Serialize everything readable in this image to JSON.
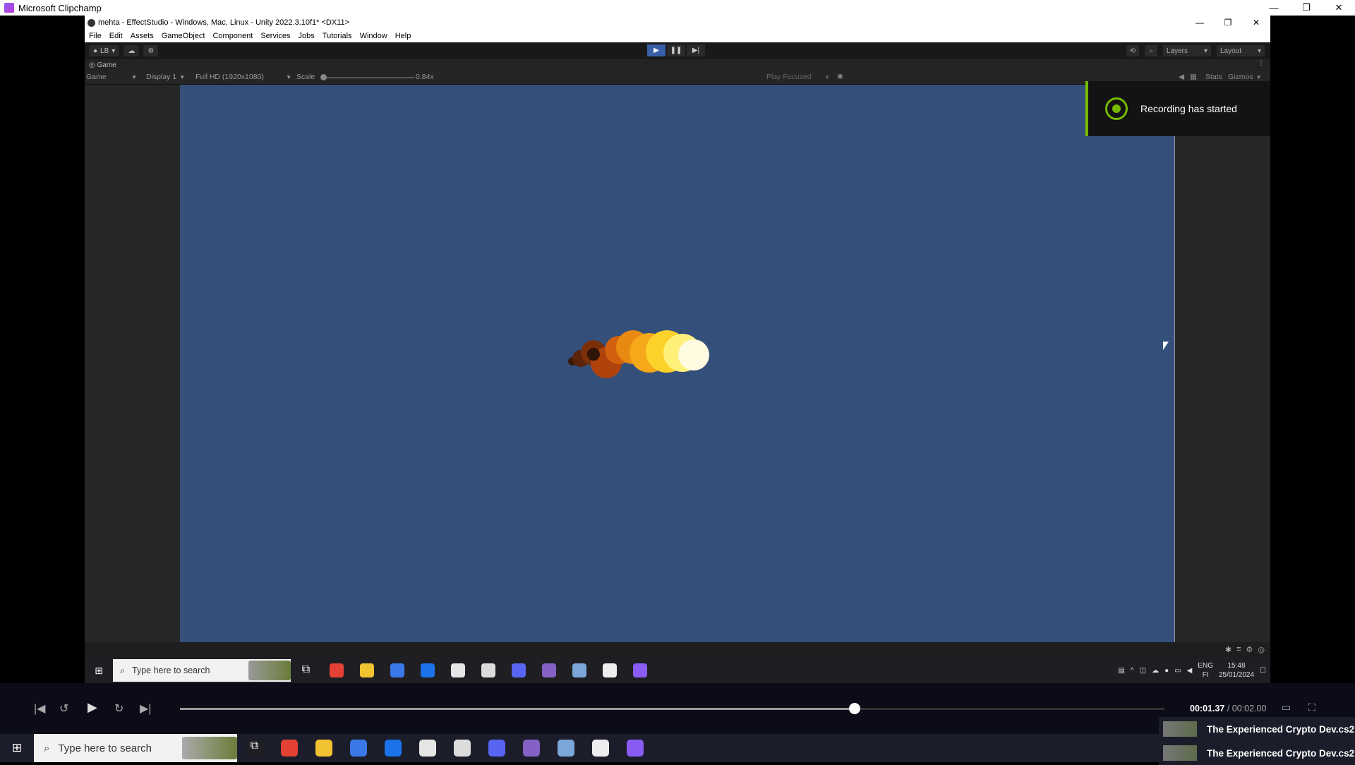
{
  "outer_window": {
    "title": "Microsoft Clipchamp",
    "minimize": "—",
    "maximize": "❐",
    "close": "✕"
  },
  "unity": {
    "title": "mehta - EffectStudio - Windows, Mac, Linux - Unity 2022.3.10f1* <DX11>",
    "menu": [
      "File",
      "Edit",
      "Assets",
      "GameObject",
      "Component",
      "Services",
      "Jobs",
      "Tutorials",
      "Window",
      "Help"
    ],
    "toolbar": {
      "account_label": "LB",
      "play_icon": "▶",
      "pause_icon": "❚❚",
      "step_icon": "▶|",
      "layers_label": "Layers",
      "layout_label": "Layout"
    },
    "game_tab": {
      "label": "Game"
    },
    "game_controls": {
      "view_mode": "Game",
      "display": "Display 1",
      "resolution": "Full HD (1920x1080)",
      "scale_label": "Scale",
      "scale_value": "0.84x",
      "scale_fraction": 0,
      "play_focused": "Play Focused",
      "stats": "Stats",
      "gizmos": "Gizmos"
    }
  },
  "toast": {
    "message": "Recording has started",
    "accent": "#76b900"
  },
  "inner_taskbar": {
    "search_placeholder": "Type here to search",
    "lang": "ENG",
    "lang_sub": "FI",
    "time": "15:48",
    "date": "25/01/2024"
  },
  "player": {
    "current_time": "00:01.37",
    "total_time": "/ 00:02.00",
    "progress": 0.685
  },
  "outer_taskbar": {
    "search_placeholder": "Type here to search"
  },
  "media_notes": [
    {
      "title": "The Experienced Crypto Dev.cs2"
    },
    {
      "title": "The Experienced Crypto Dev.cs2"
    }
  ],
  "taskbar_icons": [
    {
      "name": "task-view-icon",
      "color": "#1f1f23",
      "glyph": "⧉"
    },
    {
      "name": "chrome-icon",
      "color": "#e34133",
      "glyph": ""
    },
    {
      "name": "file-explorer-icon",
      "color": "#f1c232",
      "glyph": ""
    },
    {
      "name": "store-icon",
      "color": "#3b78e7",
      "glyph": ""
    },
    {
      "name": "mail-icon",
      "color": "#1a73e8",
      "glyph": ""
    },
    {
      "name": "unity-hub-icon",
      "color": "#e6e6e6",
      "glyph": ""
    },
    {
      "name": "unity-editor-icon",
      "color": "#dcdcdc",
      "glyph": ""
    },
    {
      "name": "discord-icon",
      "color": "#5865f2",
      "glyph": ""
    },
    {
      "name": "visual-studio-icon",
      "color": "#8661c5",
      "glyph": ""
    },
    {
      "name": "app-icon",
      "color": "#7aa6d8",
      "glyph": ""
    },
    {
      "name": "twitch-icon",
      "color": "#eeeeee",
      "glyph": ""
    },
    {
      "name": "clipchamp-icon",
      "color": "#8a5cf6",
      "glyph": ""
    }
  ]
}
